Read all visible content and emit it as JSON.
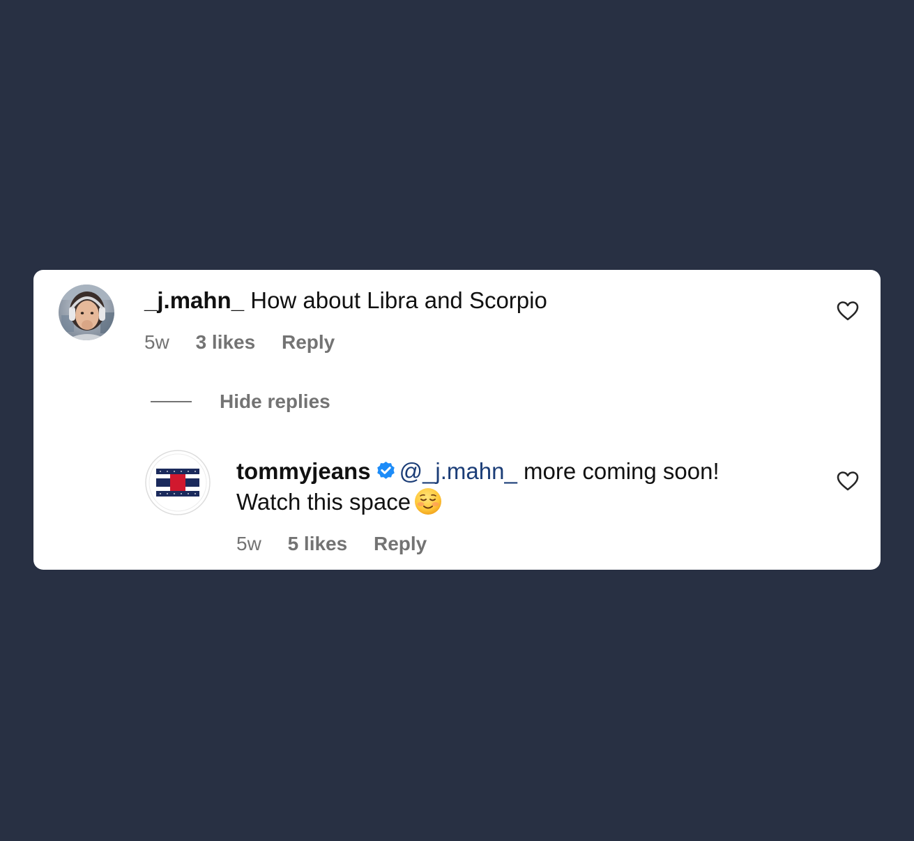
{
  "comments": [
    {
      "username": "_j.mahn_",
      "text": "How about Libra and Scorpio",
      "age": "5w",
      "likes": "3 likes",
      "reply_label": "Reply"
    }
  ],
  "toggle_label": "Hide replies",
  "reply": {
    "username": "tommyjeans",
    "verified": true,
    "mention": "@_j.mahn_",
    "text_line1": "more coming soon!",
    "text_line2": "Watch this space",
    "emoji": "smiling-face-emoji",
    "age": "5w",
    "likes": "5 likes",
    "reply_label": "Reply"
  },
  "colors": {
    "background": "#283043",
    "card": "#ffffff",
    "text": "#111111",
    "muted": "#737373",
    "mention": "#1b3d77",
    "verified": "#1d8cf8",
    "flag_navy": "#1b2a5c",
    "flag_red": "#d1182e"
  },
  "icons": [
    "heart-icon",
    "verified-badge-icon"
  ]
}
